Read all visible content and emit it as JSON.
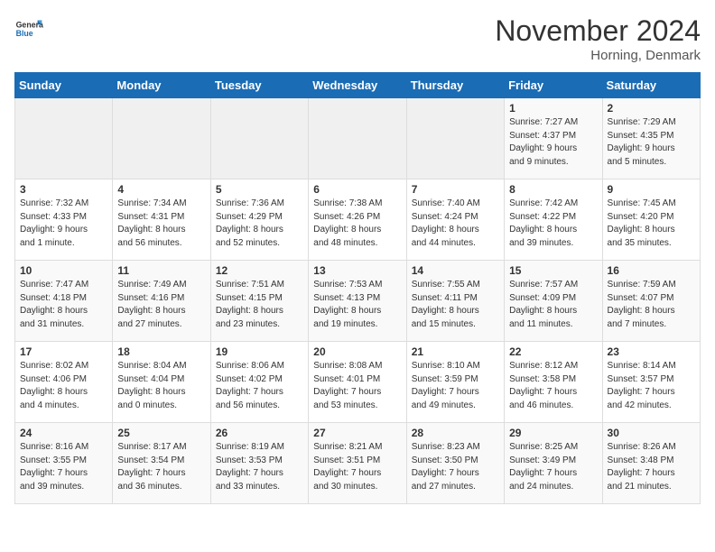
{
  "logo": {
    "text_general": "General",
    "text_blue": "Blue"
  },
  "header": {
    "month": "November 2024",
    "location": "Horning, Denmark"
  },
  "weekdays": [
    "Sunday",
    "Monday",
    "Tuesday",
    "Wednesday",
    "Thursday",
    "Friday",
    "Saturday"
  ],
  "weeks": [
    {
      "days": [
        {
          "num": "",
          "info": "",
          "empty": true
        },
        {
          "num": "",
          "info": "",
          "empty": true
        },
        {
          "num": "",
          "info": "",
          "empty": true
        },
        {
          "num": "",
          "info": "",
          "empty": true
        },
        {
          "num": "",
          "info": "",
          "empty": true
        },
        {
          "num": "1",
          "info": "Sunrise: 7:27 AM\nSunset: 4:37 PM\nDaylight: 9 hours\nand 9 minutes.",
          "empty": false
        },
        {
          "num": "2",
          "info": "Sunrise: 7:29 AM\nSunset: 4:35 PM\nDaylight: 9 hours\nand 5 minutes.",
          "empty": false
        }
      ]
    },
    {
      "days": [
        {
          "num": "3",
          "info": "Sunrise: 7:32 AM\nSunset: 4:33 PM\nDaylight: 9 hours\nand 1 minute.",
          "empty": false
        },
        {
          "num": "4",
          "info": "Sunrise: 7:34 AM\nSunset: 4:31 PM\nDaylight: 8 hours\nand 56 minutes.",
          "empty": false
        },
        {
          "num": "5",
          "info": "Sunrise: 7:36 AM\nSunset: 4:29 PM\nDaylight: 8 hours\nand 52 minutes.",
          "empty": false
        },
        {
          "num": "6",
          "info": "Sunrise: 7:38 AM\nSunset: 4:26 PM\nDaylight: 8 hours\nand 48 minutes.",
          "empty": false
        },
        {
          "num": "7",
          "info": "Sunrise: 7:40 AM\nSunset: 4:24 PM\nDaylight: 8 hours\nand 44 minutes.",
          "empty": false
        },
        {
          "num": "8",
          "info": "Sunrise: 7:42 AM\nSunset: 4:22 PM\nDaylight: 8 hours\nand 39 minutes.",
          "empty": false
        },
        {
          "num": "9",
          "info": "Sunrise: 7:45 AM\nSunset: 4:20 PM\nDaylight: 8 hours\nand 35 minutes.",
          "empty": false
        }
      ]
    },
    {
      "days": [
        {
          "num": "10",
          "info": "Sunrise: 7:47 AM\nSunset: 4:18 PM\nDaylight: 8 hours\nand 31 minutes.",
          "empty": false
        },
        {
          "num": "11",
          "info": "Sunrise: 7:49 AM\nSunset: 4:16 PM\nDaylight: 8 hours\nand 27 minutes.",
          "empty": false
        },
        {
          "num": "12",
          "info": "Sunrise: 7:51 AM\nSunset: 4:15 PM\nDaylight: 8 hours\nand 23 minutes.",
          "empty": false
        },
        {
          "num": "13",
          "info": "Sunrise: 7:53 AM\nSunset: 4:13 PM\nDaylight: 8 hours\nand 19 minutes.",
          "empty": false
        },
        {
          "num": "14",
          "info": "Sunrise: 7:55 AM\nSunset: 4:11 PM\nDaylight: 8 hours\nand 15 minutes.",
          "empty": false
        },
        {
          "num": "15",
          "info": "Sunrise: 7:57 AM\nSunset: 4:09 PM\nDaylight: 8 hours\nand 11 minutes.",
          "empty": false
        },
        {
          "num": "16",
          "info": "Sunrise: 7:59 AM\nSunset: 4:07 PM\nDaylight: 8 hours\nand 7 minutes.",
          "empty": false
        }
      ]
    },
    {
      "days": [
        {
          "num": "17",
          "info": "Sunrise: 8:02 AM\nSunset: 4:06 PM\nDaylight: 8 hours\nand 4 minutes.",
          "empty": false
        },
        {
          "num": "18",
          "info": "Sunrise: 8:04 AM\nSunset: 4:04 PM\nDaylight: 8 hours\nand 0 minutes.",
          "empty": false
        },
        {
          "num": "19",
          "info": "Sunrise: 8:06 AM\nSunset: 4:02 PM\nDaylight: 7 hours\nand 56 minutes.",
          "empty": false
        },
        {
          "num": "20",
          "info": "Sunrise: 8:08 AM\nSunset: 4:01 PM\nDaylight: 7 hours\nand 53 minutes.",
          "empty": false
        },
        {
          "num": "21",
          "info": "Sunrise: 8:10 AM\nSunset: 3:59 PM\nDaylight: 7 hours\nand 49 minutes.",
          "empty": false
        },
        {
          "num": "22",
          "info": "Sunrise: 8:12 AM\nSunset: 3:58 PM\nDaylight: 7 hours\nand 46 minutes.",
          "empty": false
        },
        {
          "num": "23",
          "info": "Sunrise: 8:14 AM\nSunset: 3:57 PM\nDaylight: 7 hours\nand 42 minutes.",
          "empty": false
        }
      ]
    },
    {
      "days": [
        {
          "num": "24",
          "info": "Sunrise: 8:16 AM\nSunset: 3:55 PM\nDaylight: 7 hours\nand 39 minutes.",
          "empty": false
        },
        {
          "num": "25",
          "info": "Sunrise: 8:17 AM\nSunset: 3:54 PM\nDaylight: 7 hours\nand 36 minutes.",
          "empty": false
        },
        {
          "num": "26",
          "info": "Sunrise: 8:19 AM\nSunset: 3:53 PM\nDaylight: 7 hours\nand 33 minutes.",
          "empty": false
        },
        {
          "num": "27",
          "info": "Sunrise: 8:21 AM\nSunset: 3:51 PM\nDaylight: 7 hours\nand 30 minutes.",
          "empty": false
        },
        {
          "num": "28",
          "info": "Sunrise: 8:23 AM\nSunset: 3:50 PM\nDaylight: 7 hours\nand 27 minutes.",
          "empty": false
        },
        {
          "num": "29",
          "info": "Sunrise: 8:25 AM\nSunset: 3:49 PM\nDaylight: 7 hours\nand 24 minutes.",
          "empty": false
        },
        {
          "num": "30",
          "info": "Sunrise: 8:26 AM\nSunset: 3:48 PM\nDaylight: 7 hours\nand 21 minutes.",
          "empty": false
        }
      ]
    }
  ]
}
